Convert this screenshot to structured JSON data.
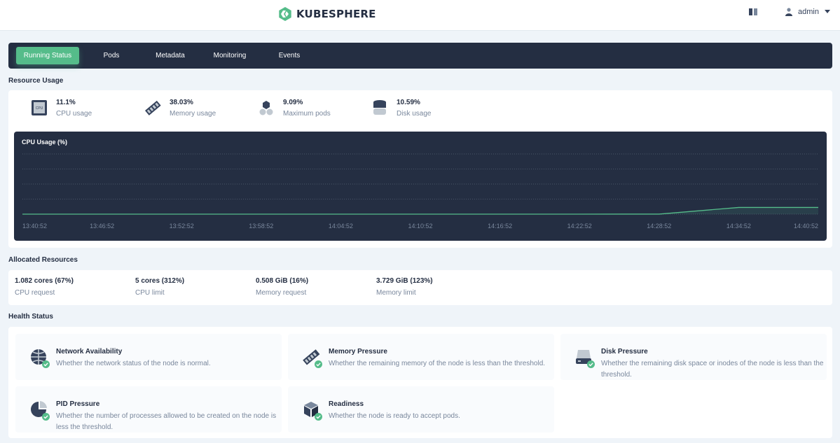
{
  "header": {
    "logo_text": "KUBESPHERE",
    "user_name": "admin",
    "brand_color": "#55bc8a"
  },
  "tabs": [
    {
      "label": "Running Status",
      "active": true
    },
    {
      "label": "Pods",
      "active": false
    },
    {
      "label": "Metadata",
      "active": false
    },
    {
      "label": "Monitoring",
      "active": false
    },
    {
      "label": "Events",
      "active": false
    }
  ],
  "resource_usage": {
    "title": "Resource Usage",
    "metrics": [
      {
        "value": "11.1%",
        "label": "CPU usage",
        "icon": "cpu-icon"
      },
      {
        "value": "38.03%",
        "label": "Memory usage",
        "icon": "memory-icon"
      },
      {
        "value": "9.09%",
        "label": "Maximum pods",
        "icon": "pods-icon"
      },
      {
        "value": "10.59%",
        "label": "Disk usage",
        "icon": "disk-icon"
      }
    ]
  },
  "chart_data": {
    "type": "area",
    "title": "CPU Usage (%)",
    "x": [
      "13:40:52",
      "13:46:52",
      "13:52:52",
      "13:58:52",
      "14:04:52",
      "14:10:52",
      "14:16:52",
      "14:22:52",
      "14:28:52",
      "14:34:52",
      "14:40:52"
    ],
    "series": [
      {
        "values": [
          0,
          0,
          0,
          0,
          0,
          0,
          0,
          0,
          0.1,
          11.1,
          11.1
        ]
      }
    ],
    "ylim": [
      0,
      100
    ],
    "grid": true,
    "line_color": "#55bc8a"
  },
  "allocated": {
    "title": "Allocated Resources",
    "items": [
      {
        "value": "1.082 cores (67%)",
        "label": "CPU request"
      },
      {
        "value": "5 cores (312%)",
        "label": "CPU limit"
      },
      {
        "value": "0.508 GiB (16%)",
        "label": "Memory request"
      },
      {
        "value": "3.729 GiB (123%)",
        "label": "Memory limit"
      }
    ]
  },
  "health": {
    "title": "Health Status",
    "items": [
      {
        "title": "Network Availability",
        "desc": "Whether the network status of the node is normal.",
        "icon": "network-icon"
      },
      {
        "title": "Memory Pressure",
        "desc": "Whether the remaining memory of the node is less than the threshold.",
        "icon": "memory-icon"
      },
      {
        "title": "Disk Pressure",
        "desc": "Whether the remaining disk space or inodes of the node is less than the threshold.",
        "icon": "disk-icon"
      },
      {
        "title": "PID Pressure",
        "desc": "Whether the number of processes allowed to be created on the node is less the threshold.",
        "icon": "pid-icon"
      },
      {
        "title": "Readiness",
        "desc": "Whether the node is ready to accept pods.",
        "icon": "readiness-icon"
      }
    ]
  }
}
